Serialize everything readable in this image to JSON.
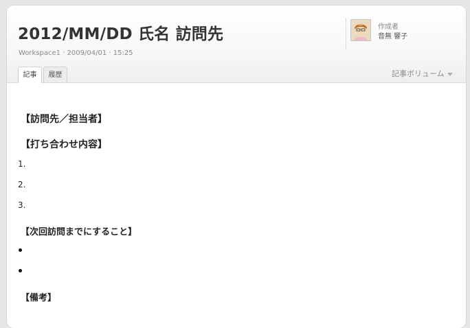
{
  "page": {
    "title": "2012/MM/DD 氏名 訪問先",
    "meta": "Workspace1 · 2009/04/01 · 15:25"
  },
  "author": {
    "label": "作成者",
    "name": "音無 響子",
    "avatar_icon": "user-avatar-icon"
  },
  "tabs": [
    {
      "label": "記事",
      "active": true
    },
    {
      "label": "履歴",
      "active": false
    }
  ],
  "volume": {
    "label": "記事ボリューム",
    "icon": "caret-down-icon"
  },
  "article": {
    "heading_visit": "【訪問先／担当者】",
    "heading_meeting": "【打ち合わせ内容】",
    "numbered_items": [
      "1.",
      "2.",
      "3."
    ],
    "heading_todo": "【次回訪問までにすること】",
    "bullet_count": 2,
    "heading_notes": "【備考】"
  }
}
